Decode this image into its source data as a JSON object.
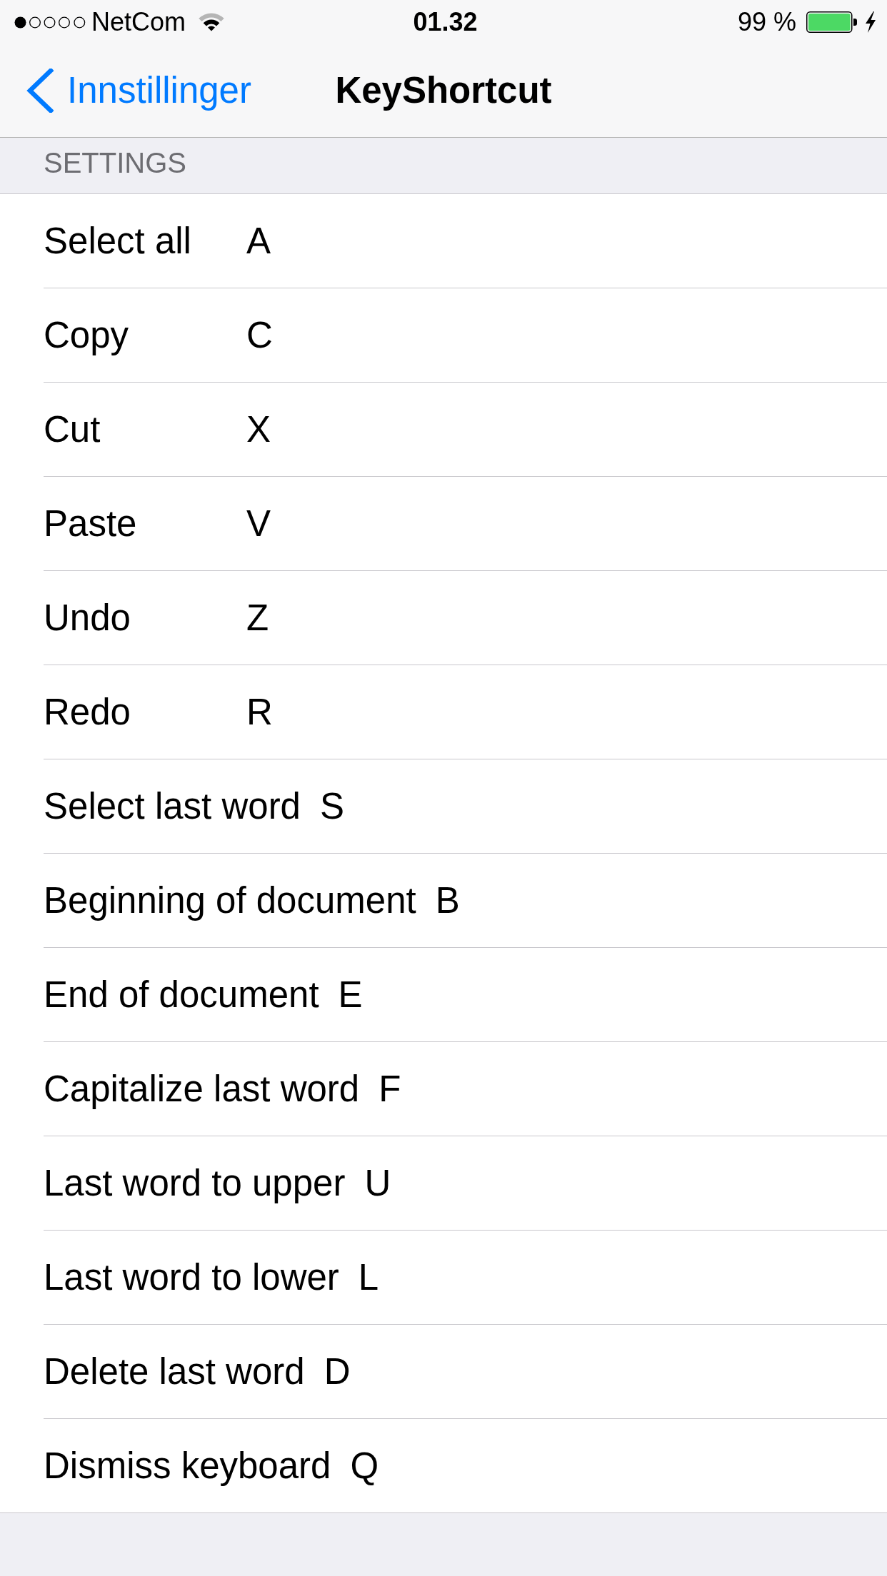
{
  "status_bar": {
    "carrier": "NetCom",
    "time": "01.32",
    "battery_text": "99 %",
    "charging": true
  },
  "nav_bar": {
    "back_label": "Innstillinger",
    "title": "KeyShortcut"
  },
  "section": {
    "header": "SETTINGS",
    "rows": [
      {
        "label": "Select all",
        "key": "A"
      },
      {
        "label": "Copy",
        "key": "C"
      },
      {
        "label": "Cut",
        "key": "X"
      },
      {
        "label": "Paste",
        "key": "V"
      },
      {
        "label": "Undo",
        "key": "Z"
      },
      {
        "label": "Redo",
        "key": "R"
      },
      {
        "label": "Select last word",
        "key": "S"
      },
      {
        "label": "Beginning of document",
        "key": "B"
      },
      {
        "label": "End of document",
        "key": "E"
      },
      {
        "label": "Capitalize last word",
        "key": "F"
      },
      {
        "label": "Last word to upper",
        "key": "U"
      },
      {
        "label": "Last word to lower",
        "key": "L"
      },
      {
        "label": "Delete last word",
        "key": "D"
      },
      {
        "label": "Dismiss keyboard",
        "key": "Q"
      }
    ]
  }
}
